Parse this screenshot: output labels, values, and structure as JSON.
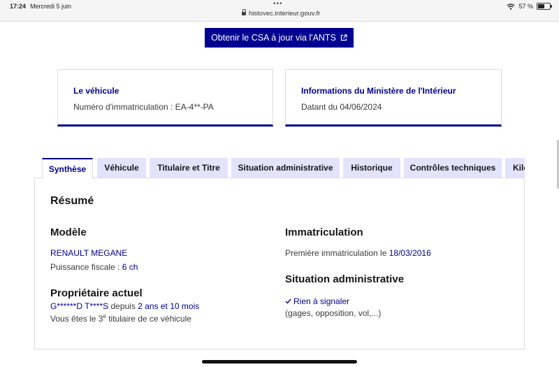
{
  "status_bar": {
    "time": "17:24",
    "date": "Mercredi 5 juin",
    "url": "histovec.interieur.gouv.fr",
    "battery": "57 %",
    "battery_level": 0.57
  },
  "csa_button": {
    "label": "Obtenir le CSA à jour via l'ANTS",
    "icon": "external-link-icon"
  },
  "vehicle_card": {
    "title": "Le véhicule",
    "text": "Numéro d'immatriculation : EA-4**-PA"
  },
  "ministry_card": {
    "title": "Informations du Ministère de l'Intérieur",
    "text": "Datant du 04/06/2024"
  },
  "tabs": [
    {
      "label": "Synthèse",
      "active": true
    },
    {
      "label": "Véhicule"
    },
    {
      "label": "Titulaire et Titre"
    },
    {
      "label": "Situation administrative"
    },
    {
      "label": "Historique"
    },
    {
      "label": "Contrôles techniques"
    },
    {
      "label": "Kilo"
    }
  ],
  "summary": {
    "heading": "Résumé",
    "model": {
      "heading": "Modèle",
      "name": "RENAULT MEGANE",
      "power_label": "Puissance fiscale : ",
      "power_value": "6 ch"
    },
    "owner": {
      "heading": "Propriétaire actuel",
      "name": "G******D T****S",
      "since_label": " depuis ",
      "since_value": "2 ans et 10 mois",
      "rank_prefix": "Vous êtes le ",
      "rank_number": "3",
      "rank_suffix_sup": "e",
      "rank_suffix": " titulaire de ce véhicule"
    },
    "registration": {
      "heading": "Immatriculation",
      "first_label": "Première immatriculation le ",
      "first_value": "18/03/2016"
    },
    "admin": {
      "heading": "Situation administrative",
      "status": "Rien à signaler",
      "detail": "(gages, opposition, vol,...)"
    }
  },
  "colors": {
    "primary": "#000091",
    "tab_bg": "#e3e3fd"
  }
}
